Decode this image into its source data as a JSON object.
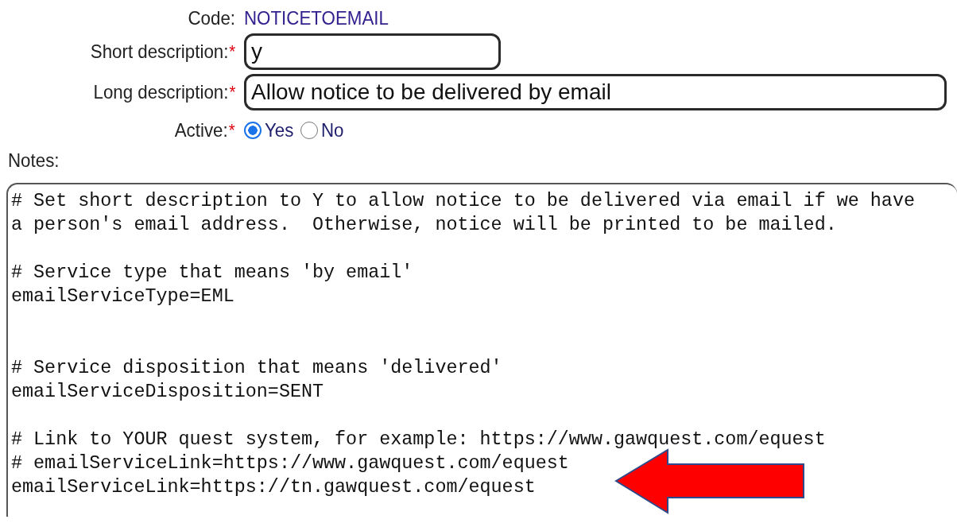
{
  "fields": [
    {
      "kind": "static",
      "label": "Code:",
      "required": false,
      "value": "NOTICETOEMAIL"
    },
    {
      "kind": "short_input",
      "label": "Short description:",
      "required": true,
      "value": "y"
    },
    {
      "kind": "long_input",
      "label": "Long description:",
      "required": true,
      "value": "Allow notice to be delivered by email"
    },
    {
      "kind": "radio",
      "label": "Active:",
      "required": true,
      "options": [
        {
          "label": "Yes",
          "selected": true
        },
        {
          "label": "No",
          "selected": false
        }
      ]
    }
  ],
  "required_mark": "*",
  "notes": {
    "label": "Notes:",
    "value": "# Set short description to Y to allow notice to be delivered via email if we have\na person's email address.  Otherwise, notice will be printed to be mailed.\n\n# Service type that means 'by email'\nemailServiceType=EML\n\n\n# Service disposition that means 'delivered'\nemailServiceDisposition=SENT\n\n# Link to YOUR quest system, for example: https://www.gawquest.com/equest\n# emailServiceLink=https://www.gawquest.com/equest\nemailServiceLink=https://tn.gawquest.com/equest"
  }
}
